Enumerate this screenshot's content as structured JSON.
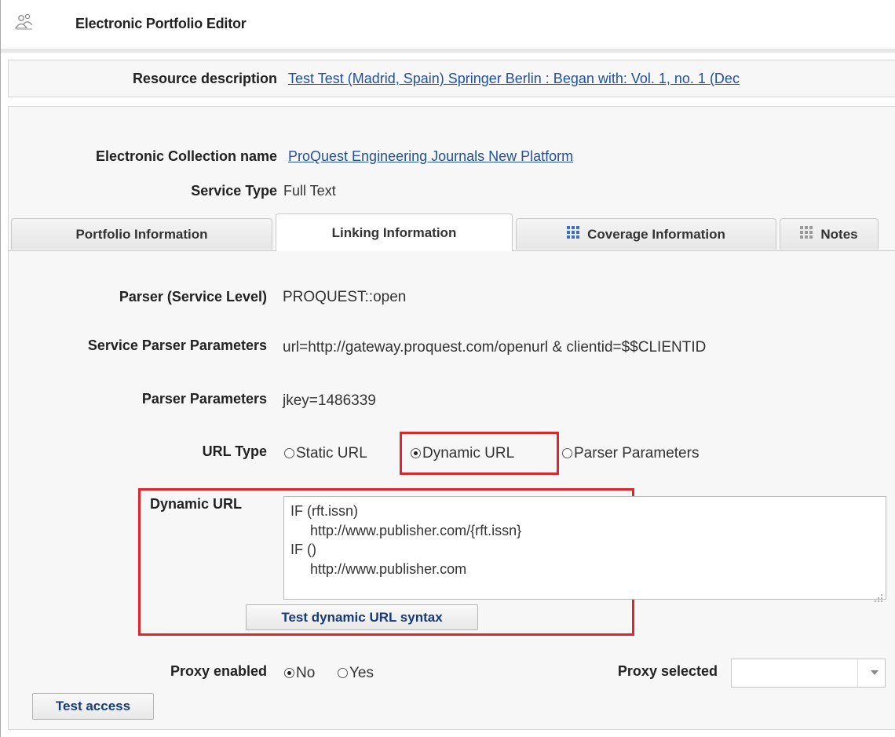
{
  "header": {
    "title": "Electronic Portfolio Editor",
    "icon": "people-icon"
  },
  "resource": {
    "label": "Resource description",
    "link": "Test Test (Madrid, Spain) Springer Berlin : Began with: Vol. 1, no. 1 (Dec"
  },
  "collection": {
    "label": "Electronic Collection name",
    "link": "ProQuest Engineering Journals New Platform",
    "service_type_label": "Service Type",
    "service_type_value": "Full Text"
  },
  "tabs": [
    {
      "label": "Portfolio Information",
      "active": false,
      "icon": ""
    },
    {
      "label": "Linking Information",
      "active": true,
      "icon": ""
    },
    {
      "label": "Coverage Information",
      "active": false,
      "icon": "grid-icon"
    },
    {
      "label": "Notes",
      "active": false,
      "icon": "grid-icon"
    }
  ],
  "linking": {
    "parser_service_level_label": "Parser (Service Level)",
    "parser_service_level_value": "PROQUEST::open",
    "service_parser_params_label": "Service Parser Parameters",
    "service_parser_params_value": "url=http://gateway.proquest.com/openurl & clientid=$$CLIENTID",
    "parser_params_label": "Parser Parameters",
    "parser_params_value": "jkey=1486339",
    "url_type_label": "URL Type",
    "url_type_options": [
      "Static URL",
      "Dynamic URL",
      "Parser Parameters"
    ],
    "url_type_selected": "Dynamic URL",
    "dynamic_url_label": "Dynamic URL",
    "dynamic_url_lines": [
      "IF (rft.issn)",
      "     http://www.publisher.com/{rft.issn}",
      "IF ()",
      "     http://www.publisher.com"
    ],
    "test_syntax_button": "Test dynamic URL syntax",
    "proxy_enabled_label": "Proxy enabled",
    "proxy_options": [
      "No",
      "Yes"
    ],
    "proxy_selected_option": "No",
    "proxy_selected_label": "Proxy selected",
    "proxy_selected_value": "",
    "test_access_button": "Test access"
  },
  "colors": {
    "link": "#2150a5",
    "highlight": "#e0252b",
    "panel": "#f7f7f7"
  }
}
